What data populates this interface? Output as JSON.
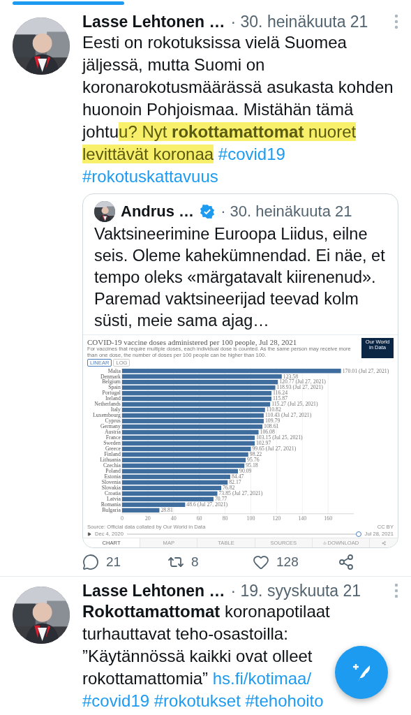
{
  "tweets": [
    {
      "author": "Lasse Lehtonen …",
      "date": "· 30. heinäkuuta 21",
      "body": [
        {
          "kind": "text",
          "text": "Eesti on rokotuksissa vielä Suomea jäljessä, mutta Suomi on koronarokotusmäärässä asukasta kohden huonoin Pohjoismaa. Mistähän tämä johtu"
        },
        {
          "kind": "highlight",
          "text": "u? Nyt **rokottamattomat** nuoret levittävät koronaa"
        },
        {
          "kind": "hashtag",
          "text": "#covid19"
        },
        {
          "kind": "hashtag",
          "text": "#rokotuskattavuus"
        }
      ],
      "quote": {
        "author": "Andrus …",
        "verified": true,
        "date": "· 30. heinäkuuta 21",
        "text": "Vaktsineerimine Euroopa Liidus, eilne seis. Oleme kahekümnendad. Ei näe, et tempo oleks «märgatavalt kiirenenud». Paremad vaktsineerijad teevad kolm süsti, meie sama ajag…",
        "chart": {
          "title": "COVID-19 vaccine doses administered per 100 people, Jul 28, 2021",
          "subtitle": "For vaccines that require multiple doses, each individual dose is counted. As the same person may receive more than one dose, the number of doses per 100 people can be higher than 100.",
          "logo": "Our World in Data",
          "scales": [
            {
              "label": "LINEAR",
              "selected": true
            },
            {
              "label": "LOG",
              "selected": false
            }
          ],
          "chart_data": {
            "type": "bar",
            "orientation": "horizontal",
            "categories": [
              "Malta",
              "Denmark",
              "Belgium",
              "Spain",
              "Portugal",
              "Ireland",
              "Netherlands",
              "Italy",
              "Luxembourg",
              "Cyprus",
              "Germany",
              "Austria",
              "France",
              "Sweden",
              "Greece",
              "Finland",
              "Lithuania",
              "Czechia",
              "Poland",
              "Estonia",
              "Slovenia",
              "Slovakia",
              "Croatia",
              "Latvia",
              "Romania",
              "Bulgaria"
            ],
            "series": [
              {
                "color": "#3f6e9e",
                "values": [
                  170,
                  124,
                  121,
                  119,
                  116,
                  116,
                  115,
                  111,
                  110,
                  110,
                  109,
                  106,
                  103,
                  103,
                  100,
                  98,
                  96,
                  95,
                  90,
                  84,
                  82,
                  77,
                  74,
                  71,
                  49,
                  29
                ]
              }
            ],
            "grid": true,
            "value_labels": [
              "170.01 (Jul 27, 2021)",
              "123.58",
              "120.77 (Jul 27, 2021)",
              "118.93 (Jul 27, 2021)",
              "116.24",
              "115.87",
              "115.27 (Jul 25, 2021)",
              "110.82",
              "110.43 (Jul 27, 2021)",
              "109.79",
              "108.61",
              "106.08",
              "103.15 (Jul 25, 2021)",
              "102.97",
              "99.65 (Jul 27, 2021)",
              "98.22",
              "95.76",
              "95.18",
              "90.09",
              "84.47",
              "82.17",
              "76.82",
              "73.85 (Jul 27, 2021)",
              "70.77",
              "48.6 (Jul 27, 2021)",
              "28.81"
            ],
            "xticks": [
              0,
              20,
              40,
              60,
              80,
              100,
              120,
              140,
              160
            ],
            "xlim": [
              0,
              180
            ]
          },
          "source": "Source: Official data collated by Our World in Data",
          "license": "CC BY",
          "timeline": {
            "start": "Dec 4, 2020",
            "end": "Jul 28, 2021",
            "level": 1
          },
          "tabs": [
            {
              "label": "CHART",
              "selected": true
            },
            {
              "label": "MAP",
              "selected": false
            },
            {
              "label": "TABLE",
              "selected": false
            },
            {
              "label": "SOURCES",
              "selected": false
            },
            {
              "label": "DOWNLOAD",
              "selected": false
            }
          ]
        }
      },
      "actions": [
        {
          "kind": "reply",
          "count": "21"
        },
        {
          "kind": "retweet",
          "count": "8"
        },
        {
          "kind": "like",
          "count": "128"
        },
        {
          "kind": "share"
        }
      ]
    },
    {
      "author": "Lasse Lehtonen …",
      "date": "· 19. syyskuuta 21",
      "body": [
        {
          "kind": "text",
          "text": "**Rokottamattomat** koronapotilaat turhauttavat teho-osastoilla: ”Käytännössä kaikki ovat olleet rokottamattomia”"
        },
        {
          "kind": "link",
          "text": "hs.fi/kotimaa/"
        },
        {
          "kind": "hashtag",
          "text": "#covid19"
        },
        {
          "kind": "hashtag",
          "text": "#rokotukset"
        },
        {
          "kind": "hashtag",
          "text": "#tehohoito"
        }
      ]
    }
  ]
}
